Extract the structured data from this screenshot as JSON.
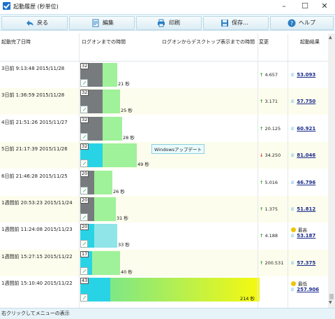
{
  "window": {
    "title": "起動履歴 (秒単位)"
  },
  "toolbar": {
    "back_label": "戻る",
    "edit_label": "編集",
    "print_label": "印刷",
    "save_label": "保存...",
    "help_label": "ヘルプ"
  },
  "columns": {
    "completed": "起動完了日時",
    "logon": "ログオンまでの時間",
    "desktop": "ログオンからデスクトップ表示までの時間",
    "change": "変更",
    "result": "起動結果"
  },
  "rows": [
    {
      "time": "3日前  9:13:48 2015/11/28",
      "logon_sec": 32,
      "desktop_sec": 21,
      "duration": "21 秒",
      "change": "4.657",
      "direction": "up",
      "score": "53.093"
    },
    {
      "time": "3日前  1:36:59 2015/11/28",
      "logon_sec": 32,
      "desktop_sec": 25,
      "duration": "25 秒",
      "change": "3.171",
      "direction": "up",
      "score": "57.750"
    },
    {
      "time": "4日前  21:51:26 2015/11/27",
      "logon_sec": 32,
      "desktop_sec": 28,
      "duration": "28 秒",
      "change": "20.125",
      "direction": "up",
      "score": "60.921"
    },
    {
      "time": "5日前  21:17:39 2015/11/26",
      "logon_sec": 32,
      "desktop_sec": 49,
      "duration": "49 秒",
      "change": "34.250",
      "direction": "down",
      "score": "81.046",
      "note": "Windowsアップデート"
    },
    {
      "time": "6日前  21:46:28 2015/11/25",
      "logon_sec": 20,
      "desktop_sec": 26,
      "duration": "26 秒",
      "change": "5.016",
      "direction": "up",
      "score": "46.796"
    },
    {
      "time": "1週間前  20:53:23 2015/11/24",
      "logon_sec": 20,
      "desktop_sec": 31,
      "duration": "31 秒",
      "change": "1.375",
      "direction": "up",
      "score": "51.812"
    },
    {
      "time": "1週間前  11:24:08 2015/11/23",
      "logon_sec": 20,
      "desktop_sec": 33,
      "duration": "33 秒",
      "change": "4.188",
      "direction": "up",
      "score": "53.187",
      "tag": "最高"
    },
    {
      "time": "1週間前  15:27:15 2015/11/22",
      "logon_sec": 17,
      "desktop_sec": 40,
      "duration": "40 秒",
      "change": "200.531",
      "direction": "up",
      "score": "57.375"
    },
    {
      "time": "1週間前  15:10:40 2015/11/22",
      "logon_sec": 43,
      "desktop_sec": 214,
      "duration": "214 秒",
      "change": "",
      "direction": "",
      "score": "257.906",
      "tag": "最低"
    }
  ],
  "status": {
    "text": "右クリックしてメニューの表示"
  }
}
